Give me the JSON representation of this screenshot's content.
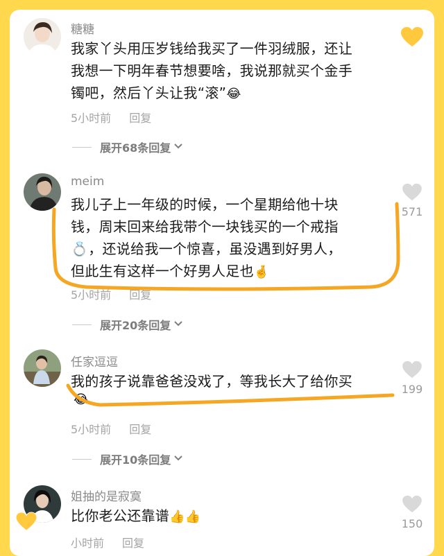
{
  "comments": [
    {
      "username": "糖糖",
      "text_lines": [
        "我家丫头用压岁钱给我买了一件羽绒服，还让",
        "我想一下明年春节想要啥，我说那就买个金手",
        "镯吧，然后丫头让我“滚”"
      ],
      "emoji": "😂",
      "time": "5小时前",
      "reply_label": "回复",
      "expand_label": "展开68条回复",
      "likes": "",
      "liked": true
    },
    {
      "username": "meim",
      "text_lines": [
        "我儿子上一年级的时候，一个星期给他十块",
        "钱，周末回来给我带个一块钱买的一个戒指",
        "💍，还说给我一个惊喜，虽没遇到好男人，",
        "但此生有这样一个好男人足也"
      ],
      "emoji": "🤞",
      "time": "5小时前",
      "reply_label": "回复",
      "expand_label": "展开20条回复",
      "likes": "571",
      "liked": false
    },
    {
      "username": "任家逗逗",
      "text_lines": [
        "我的孩子说靠爸爸没戏了，等我长大了给你买"
      ],
      "emoji": "😂",
      "time": "5小时前",
      "reply_label": "回复",
      "expand_label": "展开10条回复",
      "likes": "199",
      "liked": false
    },
    {
      "username": "姐抽的是寂寞",
      "text_lines": [
        "比你老公还靠谱"
      ],
      "emoji": "👍👍",
      "time": "小时前",
      "reply_label": "回复",
      "expand_label": "",
      "likes": "150",
      "liked": false
    }
  ],
  "colors": {
    "frame": "#ffd84d",
    "marker": "#f5a623",
    "heart_liked": "#ffc83d",
    "heart_unliked": "#d9d9d9"
  },
  "icons": {
    "like": "heart-icon",
    "expand": "chevron-down-icon"
  }
}
